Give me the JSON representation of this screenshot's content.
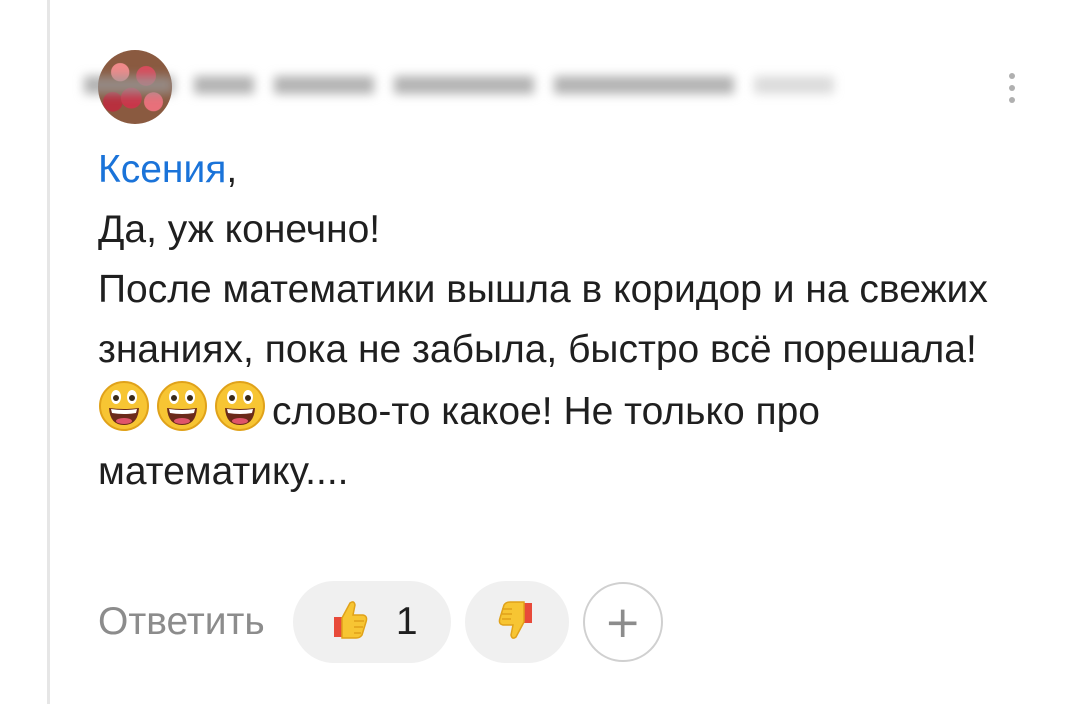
{
  "comment": {
    "mention": "Ксения",
    "mention_suffix": ",",
    "lines": [
      "Да, уж конечно!",
      "После математики вышла в коридор и на свежих знаниях, пока не забыла, быстро всё порешала!"
    ],
    "emoji_line_text": "слово-то какое! Не только про математику....",
    "emojis": [
      "grinning-face-icon",
      "grinning-face-icon",
      "grinning-face-icon"
    ]
  },
  "actions": {
    "reply_label": "Ответить",
    "like_count": "1",
    "like_icon": "thumbs-up-icon",
    "dislike_icon": "thumbs-down-icon",
    "add_reaction_label": "+"
  },
  "colors": {
    "mention": "#1a73d9",
    "text": "#1f1f1f",
    "muted": "#8c8c8c",
    "pill_bg": "#f0f0f0"
  }
}
